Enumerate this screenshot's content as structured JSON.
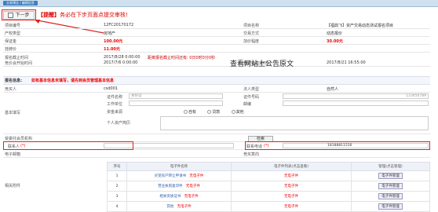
{
  "tab": {
    "label": "交易预告 / 编辑信息"
  },
  "toolbar": {
    "next_label": "下一步"
  },
  "tip": {
    "prefix": "【提醒】",
    "text": "务必在下步页面点提交审核!"
  },
  "watermark": "查看网站上公告原文",
  "fields": {
    "project_no": {
      "label": "项目编号",
      "value": "12FC20170172"
    },
    "project_name": {
      "label": "项目名称",
      "value": "【福鼎飞】资产交易动态测试报名项目"
    },
    "property_type": {
      "label": "产权类型",
      "value": "房地产"
    },
    "trade_method": {
      "label": "交易方式",
      "value": "动态报价"
    },
    "deposit": {
      "label": "保证金",
      "value": "100.00元"
    },
    "increment": {
      "label": "加价幅度",
      "value": "30.00元"
    },
    "listing_price": {
      "label": "挂牌价",
      "value": "11.00元"
    },
    "signup_deadline": {
      "label": "报名截止时间",
      "value": "2017/8/28 0:00:00",
      "note": "距离报名截止时间还有: 0日0时0分0秒"
    },
    "signup_end": {
      "label": "报名截止时间",
      "value": "2017/8/21 16:55:00"
    },
    "quote_start": {
      "label": "竞价会开始时间",
      "value": "2017/7/6 0:00:00"
    },
    "quote_end": {
      "label": "竞价会结束时间",
      "value": "2017/8/21 16:55:00"
    }
  },
  "section": {
    "title": "报名信息:",
    "notice": "如有基本信息未填写，请先到会员管理基本信息"
  },
  "applicant": {
    "name_label": "竞买人",
    "name_value": "csd001",
    "type_label": "法人类型",
    "type_value": "自然人",
    "basic_label": "基本填写",
    "id_name_label": "证件名称",
    "id_name_value": "身份证",
    "id_no_label": "证件号码",
    "id_no_value": "123456789",
    "workplace_label": "工作单位",
    "postcode_label": "邮编",
    "funding_label": "资金来源",
    "funding_options": [
      "自有",
      "贷款",
      "其他"
    ],
    "resume_label": "个人资产简历",
    "agent_label": "受委托会员机构",
    "search_label": "检索",
    "contact_label": "联系人",
    "contact_req": "(*)",
    "phone_label": "联系电话",
    "phone_req": "(*)",
    "phone_value": "18188811556",
    "email_label": "电子邮箱",
    "remark_label": "竞买意向"
  },
  "attachments": {
    "section_label": "相关附件",
    "headers": [
      "序号",
      "电子件名称",
      "电子件列表(点击查看)",
      "管理(点击管理)"
    ],
    "rows": [
      {
        "no": "1",
        "name": "买受房产转让申请书",
        "status": "无电子件",
        "manage": "电子件管理"
      },
      {
        "no": "2",
        "name": "营业执照复印件",
        "status": "无电子件",
        "manage": "电子件管理"
      },
      {
        "no": "3",
        "name": "相关资质证书",
        "status": "无电子件",
        "manage": "电子件管理"
      },
      {
        "no": "4",
        "name": "其他",
        "status": "无电子件",
        "manage": "电子件管理"
      }
    ]
  }
}
